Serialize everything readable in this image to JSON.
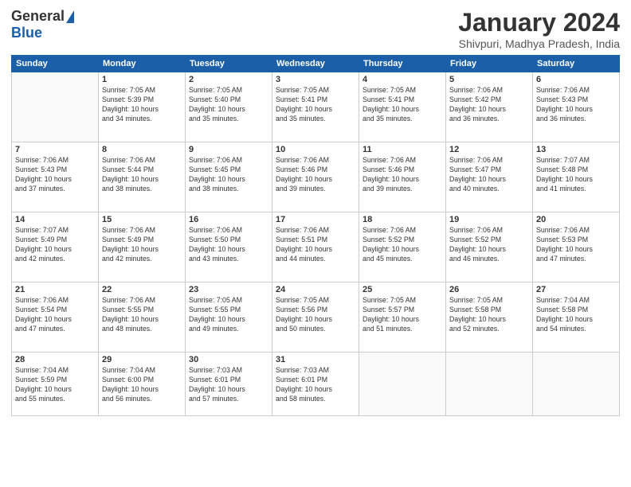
{
  "logo": {
    "general": "General",
    "blue": "Blue"
  },
  "title": {
    "month_year": "January 2024",
    "location": "Shivpuri, Madhya Pradesh, India"
  },
  "days_of_week": [
    "Sunday",
    "Monday",
    "Tuesday",
    "Wednesday",
    "Thursday",
    "Friday",
    "Saturday"
  ],
  "weeks": [
    [
      {
        "day": "",
        "info": ""
      },
      {
        "day": "1",
        "info": "Sunrise: 7:05 AM\nSunset: 5:39 PM\nDaylight: 10 hours\nand 34 minutes."
      },
      {
        "day": "2",
        "info": "Sunrise: 7:05 AM\nSunset: 5:40 PM\nDaylight: 10 hours\nand 35 minutes."
      },
      {
        "day": "3",
        "info": "Sunrise: 7:05 AM\nSunset: 5:41 PM\nDaylight: 10 hours\nand 35 minutes."
      },
      {
        "day": "4",
        "info": "Sunrise: 7:05 AM\nSunset: 5:41 PM\nDaylight: 10 hours\nand 35 minutes."
      },
      {
        "day": "5",
        "info": "Sunrise: 7:06 AM\nSunset: 5:42 PM\nDaylight: 10 hours\nand 36 minutes."
      },
      {
        "day": "6",
        "info": "Sunrise: 7:06 AM\nSunset: 5:43 PM\nDaylight: 10 hours\nand 36 minutes."
      }
    ],
    [
      {
        "day": "7",
        "info": "Sunrise: 7:06 AM\nSunset: 5:43 PM\nDaylight: 10 hours\nand 37 minutes."
      },
      {
        "day": "8",
        "info": "Sunrise: 7:06 AM\nSunset: 5:44 PM\nDaylight: 10 hours\nand 38 minutes."
      },
      {
        "day": "9",
        "info": "Sunrise: 7:06 AM\nSunset: 5:45 PM\nDaylight: 10 hours\nand 38 minutes."
      },
      {
        "day": "10",
        "info": "Sunrise: 7:06 AM\nSunset: 5:46 PM\nDaylight: 10 hours\nand 39 minutes."
      },
      {
        "day": "11",
        "info": "Sunrise: 7:06 AM\nSunset: 5:46 PM\nDaylight: 10 hours\nand 39 minutes."
      },
      {
        "day": "12",
        "info": "Sunrise: 7:06 AM\nSunset: 5:47 PM\nDaylight: 10 hours\nand 40 minutes."
      },
      {
        "day": "13",
        "info": "Sunrise: 7:07 AM\nSunset: 5:48 PM\nDaylight: 10 hours\nand 41 minutes."
      }
    ],
    [
      {
        "day": "14",
        "info": "Sunrise: 7:07 AM\nSunset: 5:49 PM\nDaylight: 10 hours\nand 42 minutes."
      },
      {
        "day": "15",
        "info": "Sunrise: 7:06 AM\nSunset: 5:49 PM\nDaylight: 10 hours\nand 42 minutes."
      },
      {
        "day": "16",
        "info": "Sunrise: 7:06 AM\nSunset: 5:50 PM\nDaylight: 10 hours\nand 43 minutes."
      },
      {
        "day": "17",
        "info": "Sunrise: 7:06 AM\nSunset: 5:51 PM\nDaylight: 10 hours\nand 44 minutes."
      },
      {
        "day": "18",
        "info": "Sunrise: 7:06 AM\nSunset: 5:52 PM\nDaylight: 10 hours\nand 45 minutes."
      },
      {
        "day": "19",
        "info": "Sunrise: 7:06 AM\nSunset: 5:52 PM\nDaylight: 10 hours\nand 46 minutes."
      },
      {
        "day": "20",
        "info": "Sunrise: 7:06 AM\nSunset: 5:53 PM\nDaylight: 10 hours\nand 47 minutes."
      }
    ],
    [
      {
        "day": "21",
        "info": "Sunrise: 7:06 AM\nSunset: 5:54 PM\nDaylight: 10 hours\nand 47 minutes."
      },
      {
        "day": "22",
        "info": "Sunrise: 7:06 AM\nSunset: 5:55 PM\nDaylight: 10 hours\nand 48 minutes."
      },
      {
        "day": "23",
        "info": "Sunrise: 7:05 AM\nSunset: 5:55 PM\nDaylight: 10 hours\nand 49 minutes."
      },
      {
        "day": "24",
        "info": "Sunrise: 7:05 AM\nSunset: 5:56 PM\nDaylight: 10 hours\nand 50 minutes."
      },
      {
        "day": "25",
        "info": "Sunrise: 7:05 AM\nSunset: 5:57 PM\nDaylight: 10 hours\nand 51 minutes."
      },
      {
        "day": "26",
        "info": "Sunrise: 7:05 AM\nSunset: 5:58 PM\nDaylight: 10 hours\nand 52 minutes."
      },
      {
        "day": "27",
        "info": "Sunrise: 7:04 AM\nSunset: 5:58 PM\nDaylight: 10 hours\nand 54 minutes."
      }
    ],
    [
      {
        "day": "28",
        "info": "Sunrise: 7:04 AM\nSunset: 5:59 PM\nDaylight: 10 hours\nand 55 minutes."
      },
      {
        "day": "29",
        "info": "Sunrise: 7:04 AM\nSunset: 6:00 PM\nDaylight: 10 hours\nand 56 minutes."
      },
      {
        "day": "30",
        "info": "Sunrise: 7:03 AM\nSunset: 6:01 PM\nDaylight: 10 hours\nand 57 minutes."
      },
      {
        "day": "31",
        "info": "Sunrise: 7:03 AM\nSunset: 6:01 PM\nDaylight: 10 hours\nand 58 minutes."
      },
      {
        "day": "",
        "info": ""
      },
      {
        "day": "",
        "info": ""
      },
      {
        "day": "",
        "info": ""
      }
    ]
  ]
}
